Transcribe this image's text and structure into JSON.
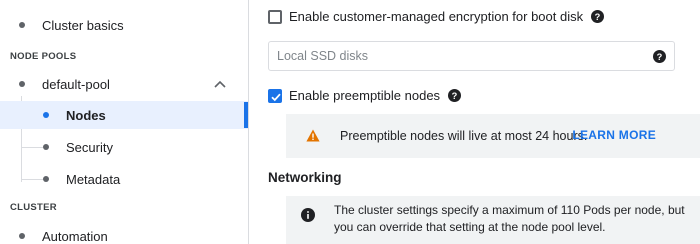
{
  "sidebar": {
    "items": [
      {
        "label": "Cluster basics"
      },
      {
        "label": "default-pool"
      },
      {
        "label": "Nodes"
      },
      {
        "label": "Security"
      },
      {
        "label": "Metadata"
      },
      {
        "label": "Automation"
      }
    ],
    "sections": {
      "node_pools": "NODE POOLS",
      "cluster": "CLUSTER"
    },
    "active_item": "Nodes"
  },
  "main": {
    "encryption_checkbox": {
      "label": "Enable customer-managed encryption for boot disk",
      "checked": false
    },
    "ssd_field": {
      "placeholder": "Local SSD disks",
      "value": ""
    },
    "preemptible_checkbox": {
      "label": "Enable preemptible nodes",
      "checked": true
    },
    "warning": {
      "text": "Preemptible nodes will live at most 24 hours.",
      "link": "LEARN MORE"
    },
    "networking": {
      "title": "Networking",
      "info_text": "The cluster settings specify a maximum of 110 Pods per node, but you can override that setting at the node pool level."
    }
  },
  "colors": {
    "accent": "#1a73e8",
    "warning": "#e37400",
    "info_bg": "#f1f3f4",
    "text": "#202124"
  }
}
